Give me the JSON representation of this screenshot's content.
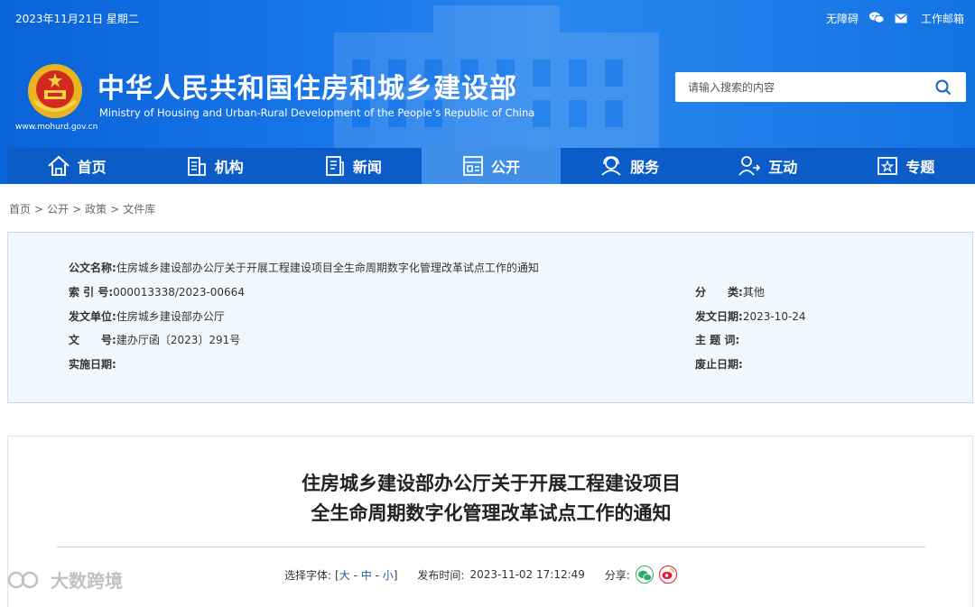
{
  "topbar": {
    "date": "2023年11月21日 星期二",
    "accessibility": "无障碍",
    "email": "工作邮箱"
  },
  "site": {
    "title": "中华人民共和国住房和城乡建设部",
    "subtitle": "Ministry of Housing and Urban-Rural Development of the People’s Republic of China",
    "domain": "www.mohurd.gov.cn"
  },
  "search": {
    "placeholder": "请输入搜索的内容"
  },
  "nav": {
    "items": [
      {
        "label": "首页",
        "icon": "home-icon"
      },
      {
        "label": "机构",
        "icon": "building-icon"
      },
      {
        "label": "新闻",
        "icon": "news-icon"
      },
      {
        "label": "公开",
        "icon": "disclosure-icon",
        "active": true
      },
      {
        "label": "服务",
        "icon": "service-icon"
      },
      {
        "label": "互动",
        "icon": "interact-icon"
      },
      {
        "label": "专题",
        "icon": "topic-icon"
      }
    ]
  },
  "breadcrumb": [
    "首页",
    "公开",
    "政策",
    "文件库"
  ],
  "meta": {
    "name_label": "公文名称:",
    "name_value": "住房城乡建设部办公厅关于开展工程建设项目全生命周期数字化管理改革试点工作的通知",
    "index_label": "索 引 号:",
    "index_value": "000013338/2023-00664",
    "category_label": "分　　类:",
    "category_value": "其他",
    "issuer_label": "发文单位:",
    "issuer_value": "住房城乡建设部办公厅",
    "issue_date_label": "发文日期:",
    "issue_date_value": "2023-10-24",
    "doc_no_label": "文　　号:",
    "doc_no_value": "建办厅函〔2023〕291号",
    "keywords_label": "主 题 词:",
    "keywords_value": "",
    "effective_label": "实施日期:",
    "effective_value": "",
    "expiry_label": "废止日期:",
    "expiry_value": ""
  },
  "article": {
    "title_line1": "住房城乡建设部办公厅关于开展工程建设项目",
    "title_line2": "全生命周期数字化管理改革试点工作的通知",
    "font_label": "选择字体:",
    "font_large": "大",
    "font_medium": "中",
    "font_small": "小",
    "publish_label": "发布时间:",
    "publish_time": "2023-11-02 17:12:49",
    "share_label": "分享:"
  },
  "watermark": "大数跨境",
  "colors": {
    "header_blue": "#1877ea",
    "nav_blue": "#0c5cc8",
    "nav_active": "#3f8fe8",
    "meta_bg": "#f2f7fd"
  }
}
